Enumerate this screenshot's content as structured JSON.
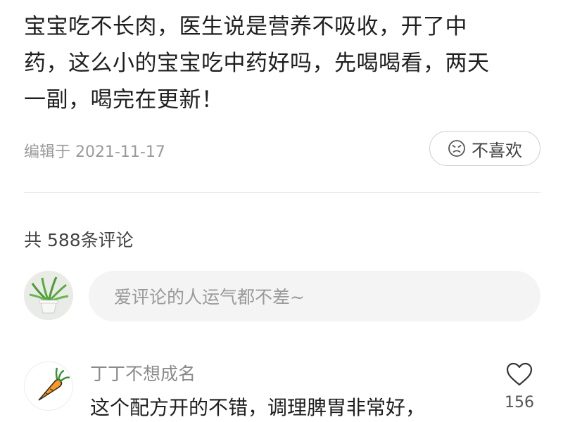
{
  "post": {
    "body_lines": [
      "宝宝吃不长肉，医生说是营养不吸收，开了中",
      "药，这么小的宝宝吃中药好吗，先喝喝看，两天",
      "一副，喝完在更新！"
    ],
    "edit_time": "编辑于 2021-11-17",
    "dislike_label": "不喜欢"
  },
  "comments_section": {
    "count_label": "共 588条评论",
    "input_placeholder": "爱评论的人运气都不差~",
    "items": [
      {
        "author": "丁丁不想成名",
        "text": "这个配方开的不错，调理脾胃非常好，",
        "likes": "156"
      }
    ]
  },
  "colors": {
    "text_primary": "#1f1f1f",
    "text_muted": "#9a9a9a",
    "input_bg": "#f4f4f4",
    "divider": "#e6e6e6"
  }
}
